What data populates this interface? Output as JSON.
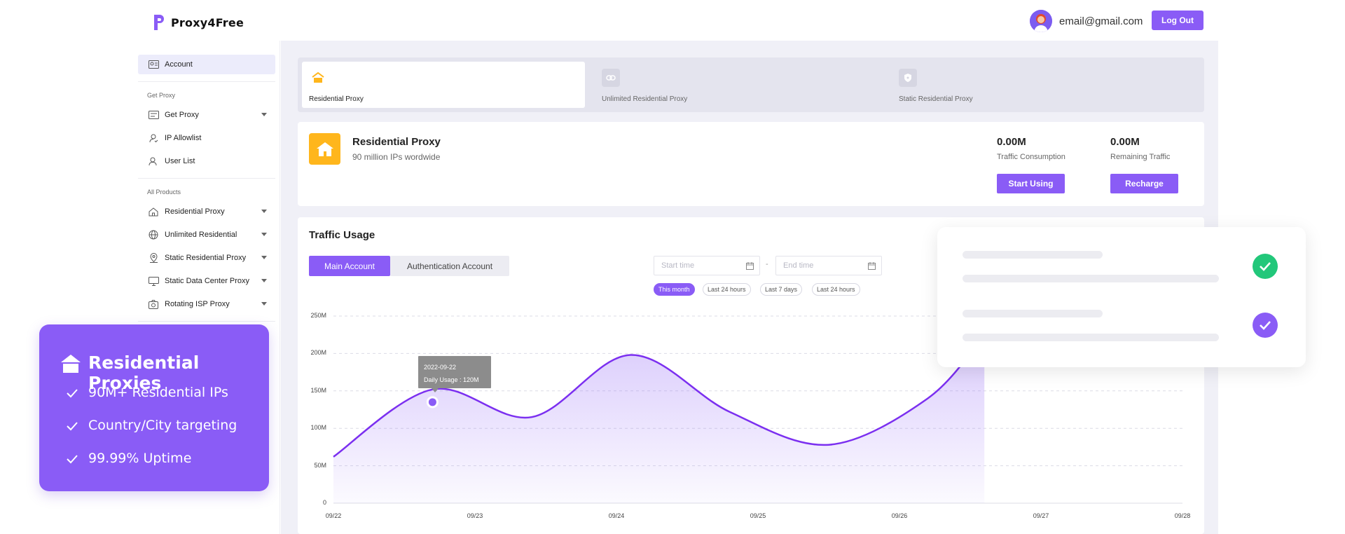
{
  "header": {
    "brand": "Proxy4Free",
    "email": "email@gmail.com",
    "logout_label": "Log Out"
  },
  "sidebar": {
    "account": "Account",
    "section_get": "Get Proxy",
    "get_items": [
      {
        "label": "Get Proxy",
        "icon": "proxy-list-icon",
        "caret": true
      },
      {
        "label": "IP Allowlist",
        "icon": "user-check-icon",
        "caret": false
      },
      {
        "label": "User List",
        "icon": "users-icon",
        "caret": false
      }
    ],
    "section_products": "All Products",
    "product_items": [
      {
        "label": "Residential Proxy",
        "icon": "home-icon"
      },
      {
        "label": "Unlimited Residential",
        "icon": "globe-icon"
      },
      {
        "label": "Static Residential Proxy",
        "icon": "location-pin-icon"
      },
      {
        "label": "Static Data Center Proxy",
        "icon": "monitor-icon"
      },
      {
        "label": "Rotating ISP Proxy",
        "icon": "camera-icon"
      }
    ]
  },
  "product_tabs": [
    {
      "label": "Residential Proxy",
      "icon": "home-icon",
      "active": true
    },
    {
      "label": "Unlimited Residential Proxy",
      "icon": "link-icon",
      "active": false
    },
    {
      "label": "Static Residential Proxy",
      "icon": "shield-icon",
      "active": false
    }
  ],
  "summary": {
    "title": "Residential Proxy",
    "subtitle": "90 million IPs wordwide",
    "consumption_value": "0.00M",
    "consumption_label": "Traffic Consumption",
    "remaining_value": "0.00M",
    "remaining_label": "Remaining Traffic",
    "start_label": "Start Using",
    "recharge_label": "Recharge"
  },
  "traffic": {
    "title": "Traffic Usage",
    "tabs": [
      "Main Account",
      "Authentication Account"
    ],
    "start_placeholder": "Start time",
    "end_placeholder": "End time",
    "range_sep": "-",
    "ranges": [
      "This month",
      "Last 24 hours",
      "Last 7 days",
      "Last 24 hours"
    ],
    "tooltip_date": "2022-09-22",
    "tooltip_usage": "Daily Usage : 120M"
  },
  "chart_data": {
    "type": "area",
    "x": [
      "09/22",
      "09/23",
      "09/24",
      "09/25",
      "09/26",
      "09/27",
      "09/28"
    ],
    "yticks": [
      "250M",
      "200M",
      "150M",
      "100M",
      "50M",
      "0"
    ],
    "ylim": [
      0,
      250
    ],
    "series": [
      {
        "points": [
          [
            0,
            62
          ],
          [
            0.7,
            152
          ],
          [
            1.4,
            115
          ],
          [
            2.1,
            198
          ],
          [
            2.8,
            122
          ],
          [
            3.5,
            78
          ],
          [
            4.2,
            140
          ],
          [
            4.6,
            225
          ]
        ]
      }
    ],
    "highlight": {
      "x": 0.7,
      "y": 135
    },
    "color": "#7b2ff0"
  },
  "promo": {
    "title": "Residential Proxies",
    "lines": [
      "90M+ Residential IPs",
      "Country/City targeting",
      "99.99% Uptime"
    ]
  },
  "colors": {
    "accent": "#8a5cf6",
    "success": "#22c77a",
    "orange": "#ffb61c"
  }
}
